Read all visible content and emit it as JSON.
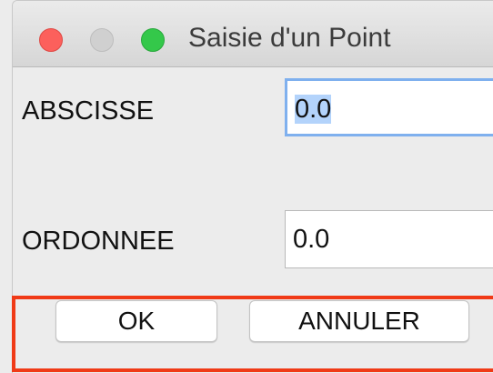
{
  "window": {
    "title": "Saisie d'un Point"
  },
  "form": {
    "abscisse_label": "ABSCISSE",
    "abscisse_value": "0.0",
    "ordonnee_label": "ORDONNEE",
    "ordonnee_value": "0.0"
  },
  "buttons": {
    "ok_label": "OK",
    "cancel_label": "ANNULER"
  },
  "colors": {
    "close": "#fc605c",
    "minimize": "#d0d0d0",
    "zoom": "#34c84a",
    "focus_ring": "#7fb0ee",
    "selection": "#b3d3fb",
    "highlight_box": "#f03a17"
  }
}
